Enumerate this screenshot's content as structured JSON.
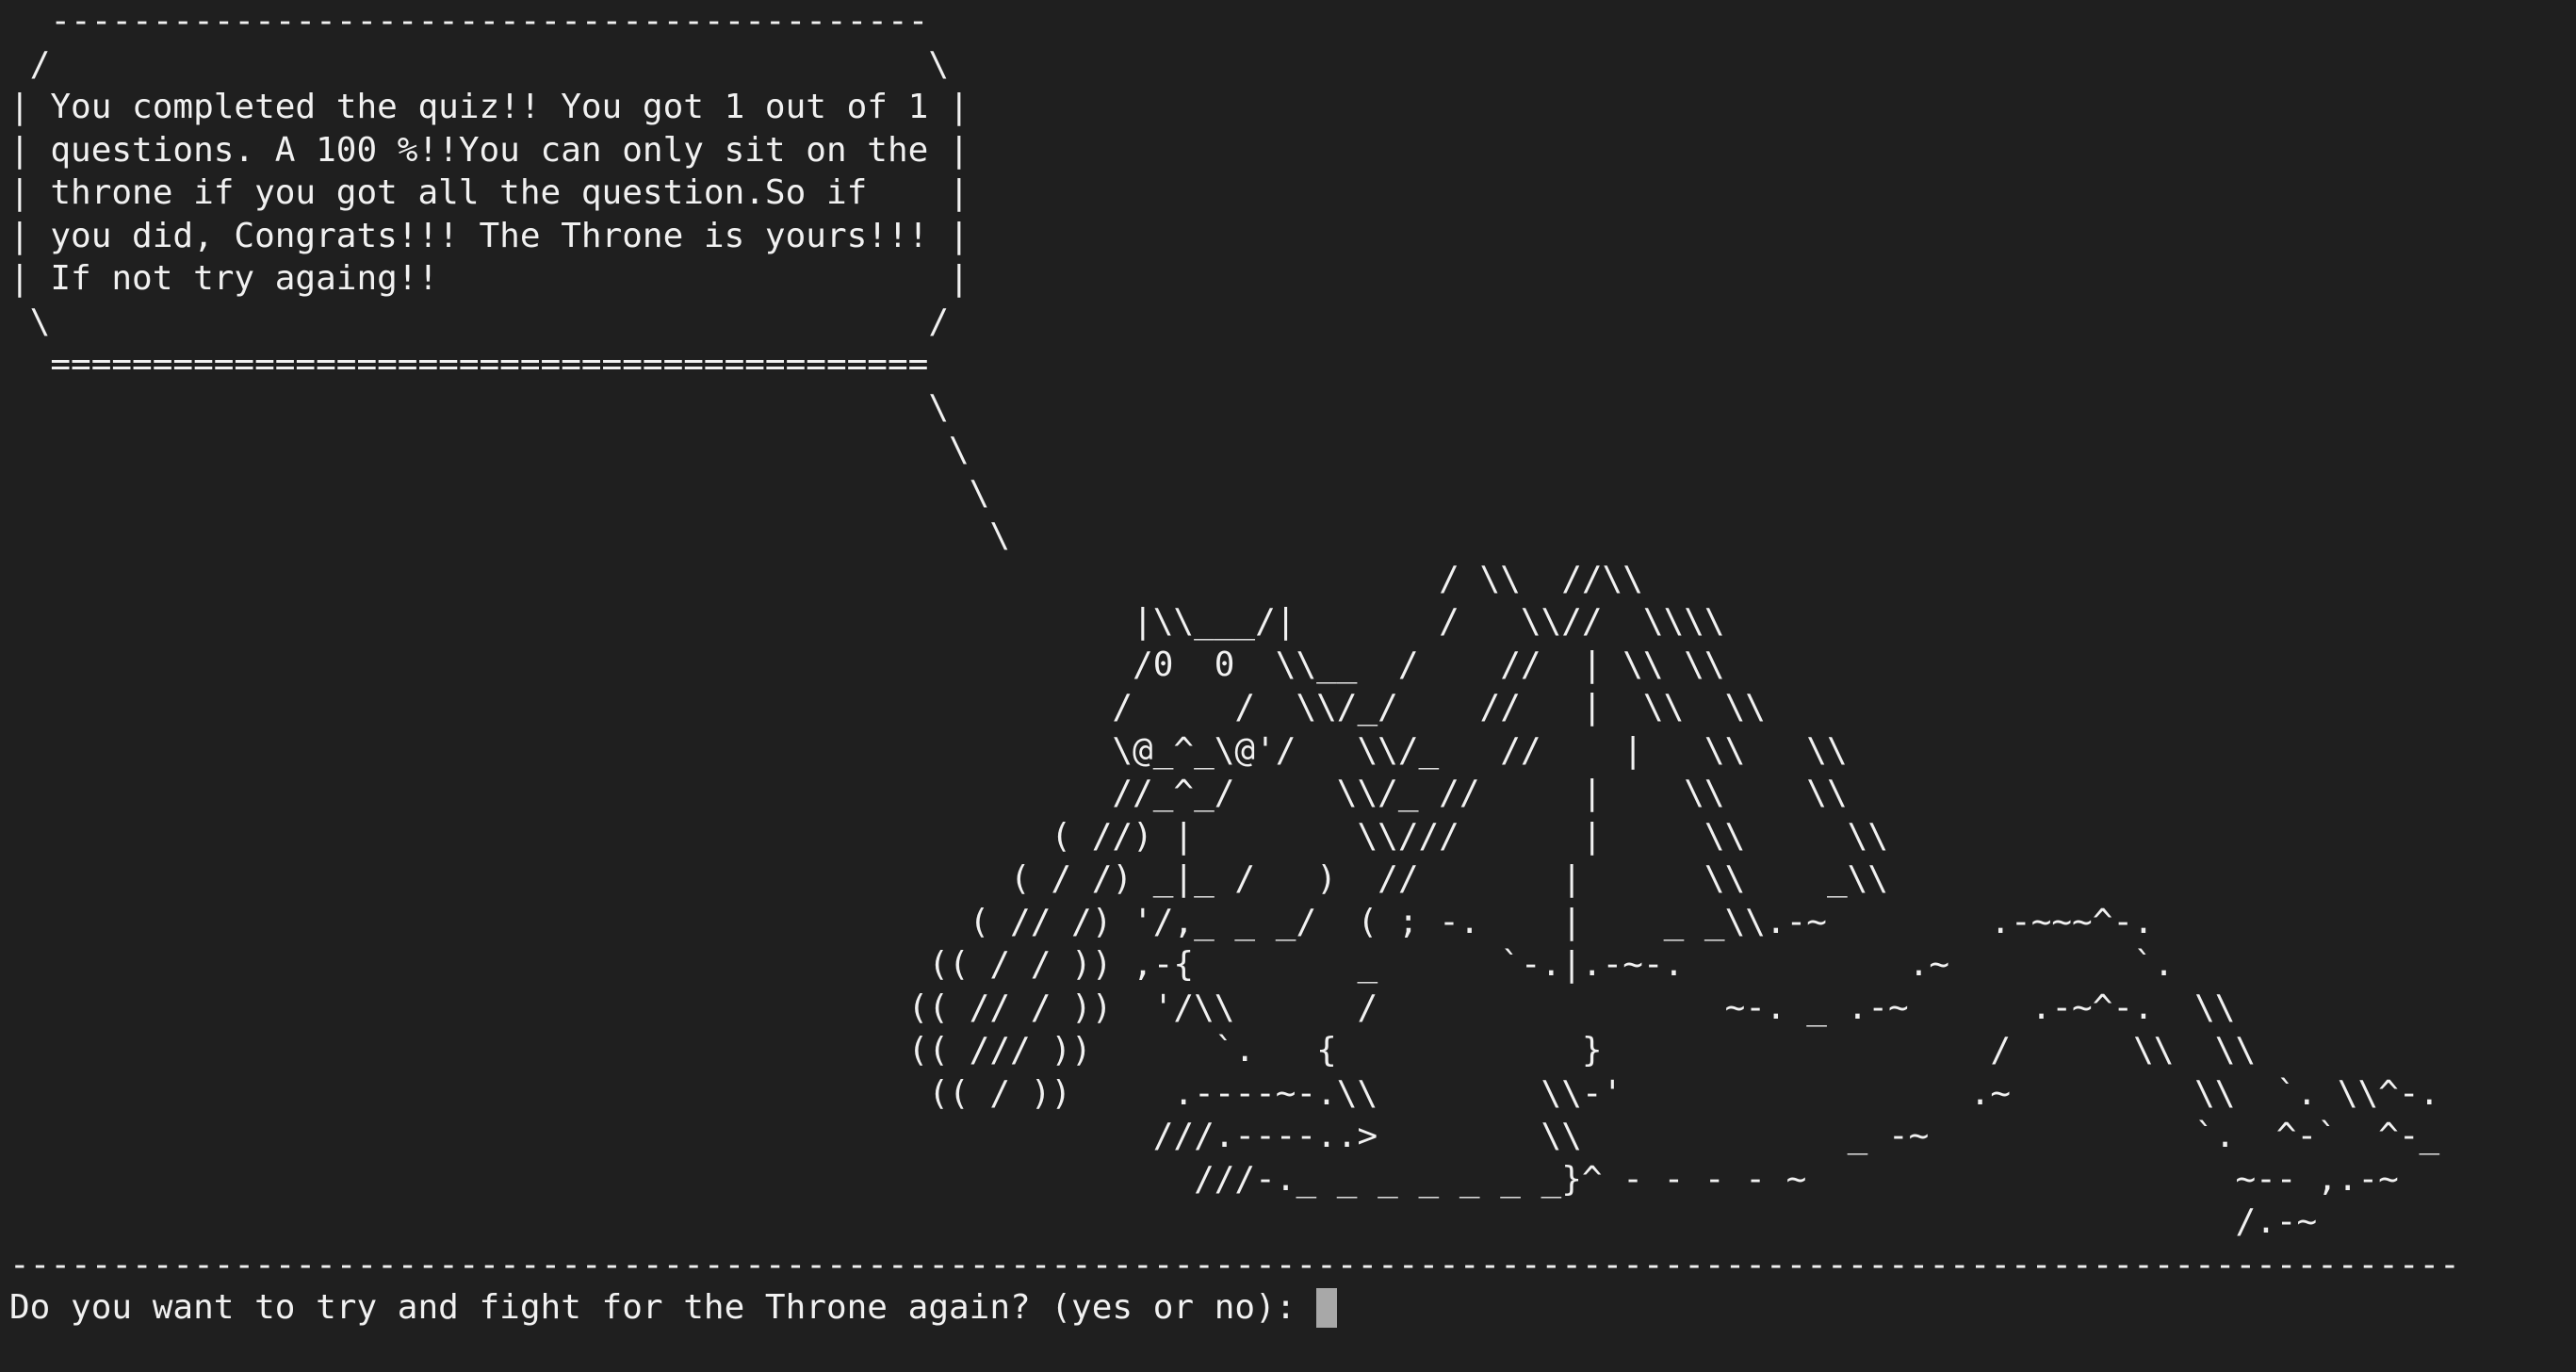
{
  "terminal": {
    "lines": [
      "  ------------------------------------------- ",
      " /                                           \\",
      "| You completed the quiz!! You got 1 out of 1 |",
      "| questions. A 100 %!!You can only sit on the |",
      "| throne if you got all the question.So if    |",
      "| you did, Congrats!!! The Throne is yours!!! |",
      "| If not try againg!!                         |",
      " \\                                           /",
      "  =========================================== ",
      "                                             \\",
      "                                              \\",
      "                                               \\",
      "                                                \\",
      "                                                                      / \\\\  //\\\\",
      "                                                       |\\\\___/|       /   \\\\//  \\\\\\\\",
      "                                                       /0  0  \\\\__  /    //  | \\\\ \\\\",
      "                                                      /     /  \\\\/_/    //   |  \\\\  \\\\",
      "                                                      \\@_^_\\@'/   \\\\/_   //    |   \\\\   \\\\",
      "                                                      //_^_/     \\\\/_ //     |    \\\\    \\\\",
      "                                                   ( //) |        \\\\///      |     \\\\     \\\\",
      "                                                 ( / /) _|_ /   )  //       |      \\\\    _\\\\",
      "                                               ( // /) '/,_ _ _/  ( ; -.    |    _ _\\\\.-~        .-~~~^-.",
      "                                             (( / / )) ,-{        _      `-.|.-~-.           .~         `.",
      "                                            (( // / ))  '/\\\\      /                 ~-. _ .-~      .-~^-.  \\\\",
      "                                            (( /// ))      `.   {            }                   /      \\\\  \\\\",
      "                                             (( / ))     .----~-.\\\\        \\\\-'                 .~         \\\\  `. \\\\^-.",
      "                                                        ///.----..>        \\\\             _ -~             `.  ^-`  ^-_",
      "                                                          ///-._ _ _ _ _ _ _}^ - - - - ~                     ~-- ,.-~",
      "                                                                                                             /.-~",
      "------------------------------------------------------------------------------------------------------------------------"
    ],
    "prompt_text": "Do you want to try and fight for the Throne again? (yes or no): "
  }
}
